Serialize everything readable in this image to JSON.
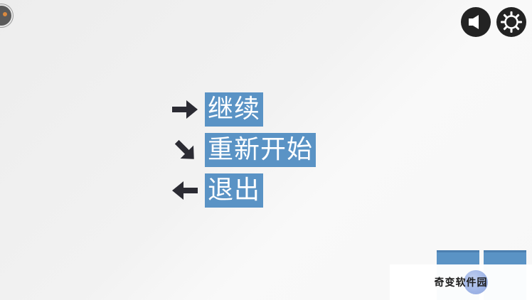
{
  "menu": {
    "items": [
      {
        "label": "继续",
        "arrow": "arrow-right-icon"
      },
      {
        "label": "重新开始",
        "arrow": "arrow-down-right-icon"
      },
      {
        "label": "退出",
        "arrow": "arrow-left-icon"
      }
    ]
  },
  "toolbar": {
    "icons": [
      "sound-icon",
      "settings-gear-icon"
    ]
  },
  "watermark": {
    "text": "奇变软件园"
  },
  "colors": {
    "accent": "#5a93c5",
    "icon_dark": "#232323",
    "arrow": "#2b2b33",
    "background": "#f1f1f1"
  }
}
